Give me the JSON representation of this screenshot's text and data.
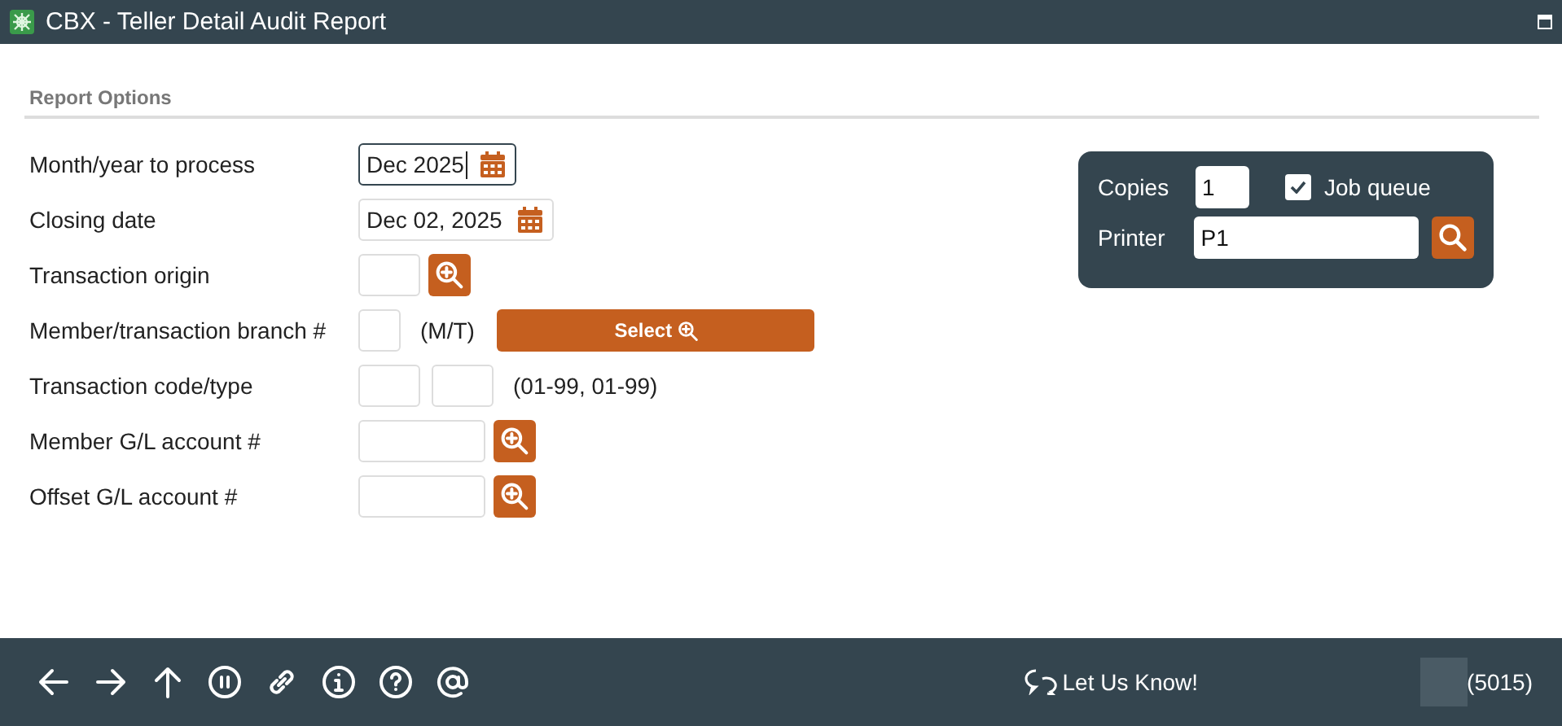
{
  "window": {
    "title": "CBX - Teller Detail Audit Report"
  },
  "section": {
    "title": "Report Options"
  },
  "rows": [
    {
      "label": "Month/year to process",
      "kind": "month",
      "value": "Dec 2025",
      "focused": true
    },
    {
      "label": "Closing date",
      "kind": "date",
      "value": "Dec 02, 2025",
      "focused": false
    },
    {
      "label": "Transaction origin",
      "kind": "origin"
    },
    {
      "label": "Member/transaction branch #",
      "kind": "branch",
      "suffix": "(M/T)",
      "button": "Select"
    },
    {
      "label": "Transaction code/type",
      "kind": "code",
      "hint": "(01-99, 01-99)"
    },
    {
      "label": "Member G/L account #",
      "kind": "account"
    },
    {
      "label": "Offset G/L account #",
      "kind": "account"
    }
  ],
  "print": {
    "copies_label": "Copies",
    "copies": "1",
    "job_queue_label": "Job queue",
    "job_queue": true,
    "printer_label": "Printer",
    "printer": "P1"
  },
  "footer": {
    "feedback": "Let Us Know!",
    "code": "(5015)"
  }
}
